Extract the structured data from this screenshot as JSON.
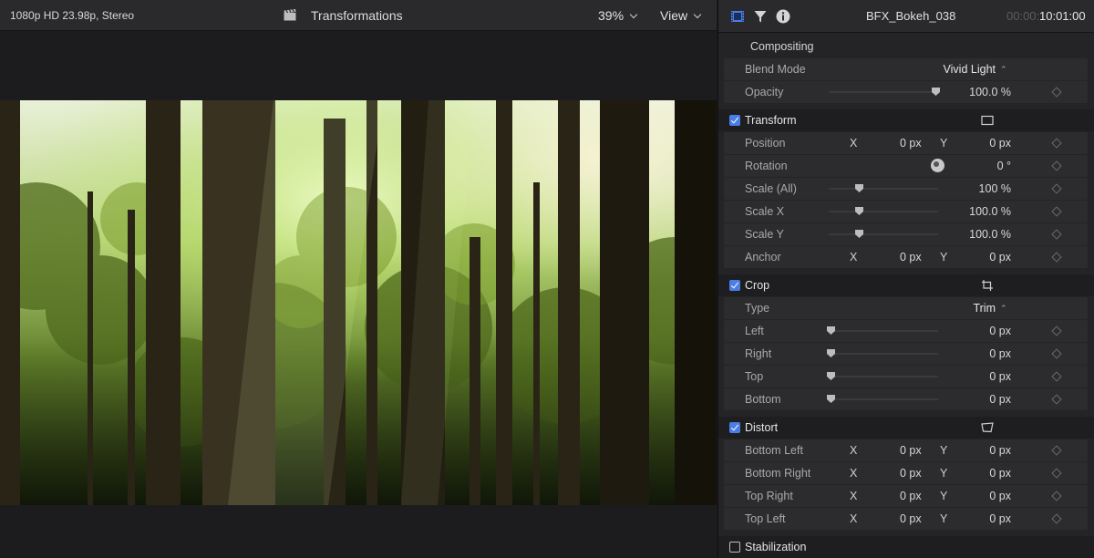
{
  "viewer": {
    "format": "1080p HD 23.98p, Stereo",
    "title": "Transformations",
    "zoom": "39%",
    "view_label": "View"
  },
  "inspector": {
    "clip_name": "BFX_Bokeh_038",
    "timecode_dim": "00:00:",
    "timecode": "10:01:00",
    "tabs": [
      "film-icon",
      "filter-icon",
      "info-icon"
    ],
    "compositing": {
      "title": "Compositing",
      "blend_mode_label": "Blend Mode",
      "blend_mode_value": "Vivid Light",
      "opacity_label": "Opacity",
      "opacity_value": "100.0 %",
      "opacity_level": 1.0
    },
    "transform": {
      "title": "Transform",
      "checked": true,
      "position_label": "Position",
      "position_x": "0 px",
      "position_y": "0 px",
      "rotation_label": "Rotation",
      "rotation_value": "0 °",
      "scale_all_label": "Scale (All)",
      "scale_all_value": "100 %",
      "scale_x_label": "Scale X",
      "scale_x_value": "100.0 %",
      "scale_y_label": "Scale Y",
      "scale_y_value": "100.0 %",
      "anchor_label": "Anchor",
      "anchor_x": "0 px",
      "anchor_y": "0 px"
    },
    "crop": {
      "title": "Crop",
      "checked": true,
      "type_label": "Type",
      "type_value": "Trim",
      "left_label": "Left",
      "left_value": "0 px",
      "right_label": "Right",
      "right_value": "0 px",
      "top_label": "Top",
      "top_value": "0 px",
      "bottom_label": "Bottom",
      "bottom_value": "0 px"
    },
    "distort": {
      "title": "Distort",
      "checked": true,
      "bottom_left_label": "Bottom Left",
      "bottom_left_x": "0 px",
      "bottom_left_y": "0 px",
      "bottom_right_label": "Bottom Right",
      "bottom_right_x": "0 px",
      "bottom_right_y": "0 px",
      "top_right_label": "Top Right",
      "top_right_x": "0 px",
      "top_right_y": "0 px",
      "top_left_label": "Top Left",
      "top_left_x": "0 px",
      "top_left_y": "0 px"
    },
    "stabilization": {
      "title": "Stabilization",
      "checked": false
    },
    "x_label": "X",
    "y_label": "Y"
  },
  "colors": {
    "accent": "#4a7ee6",
    "panel": "#242426",
    "row": "#2c2c2f"
  }
}
